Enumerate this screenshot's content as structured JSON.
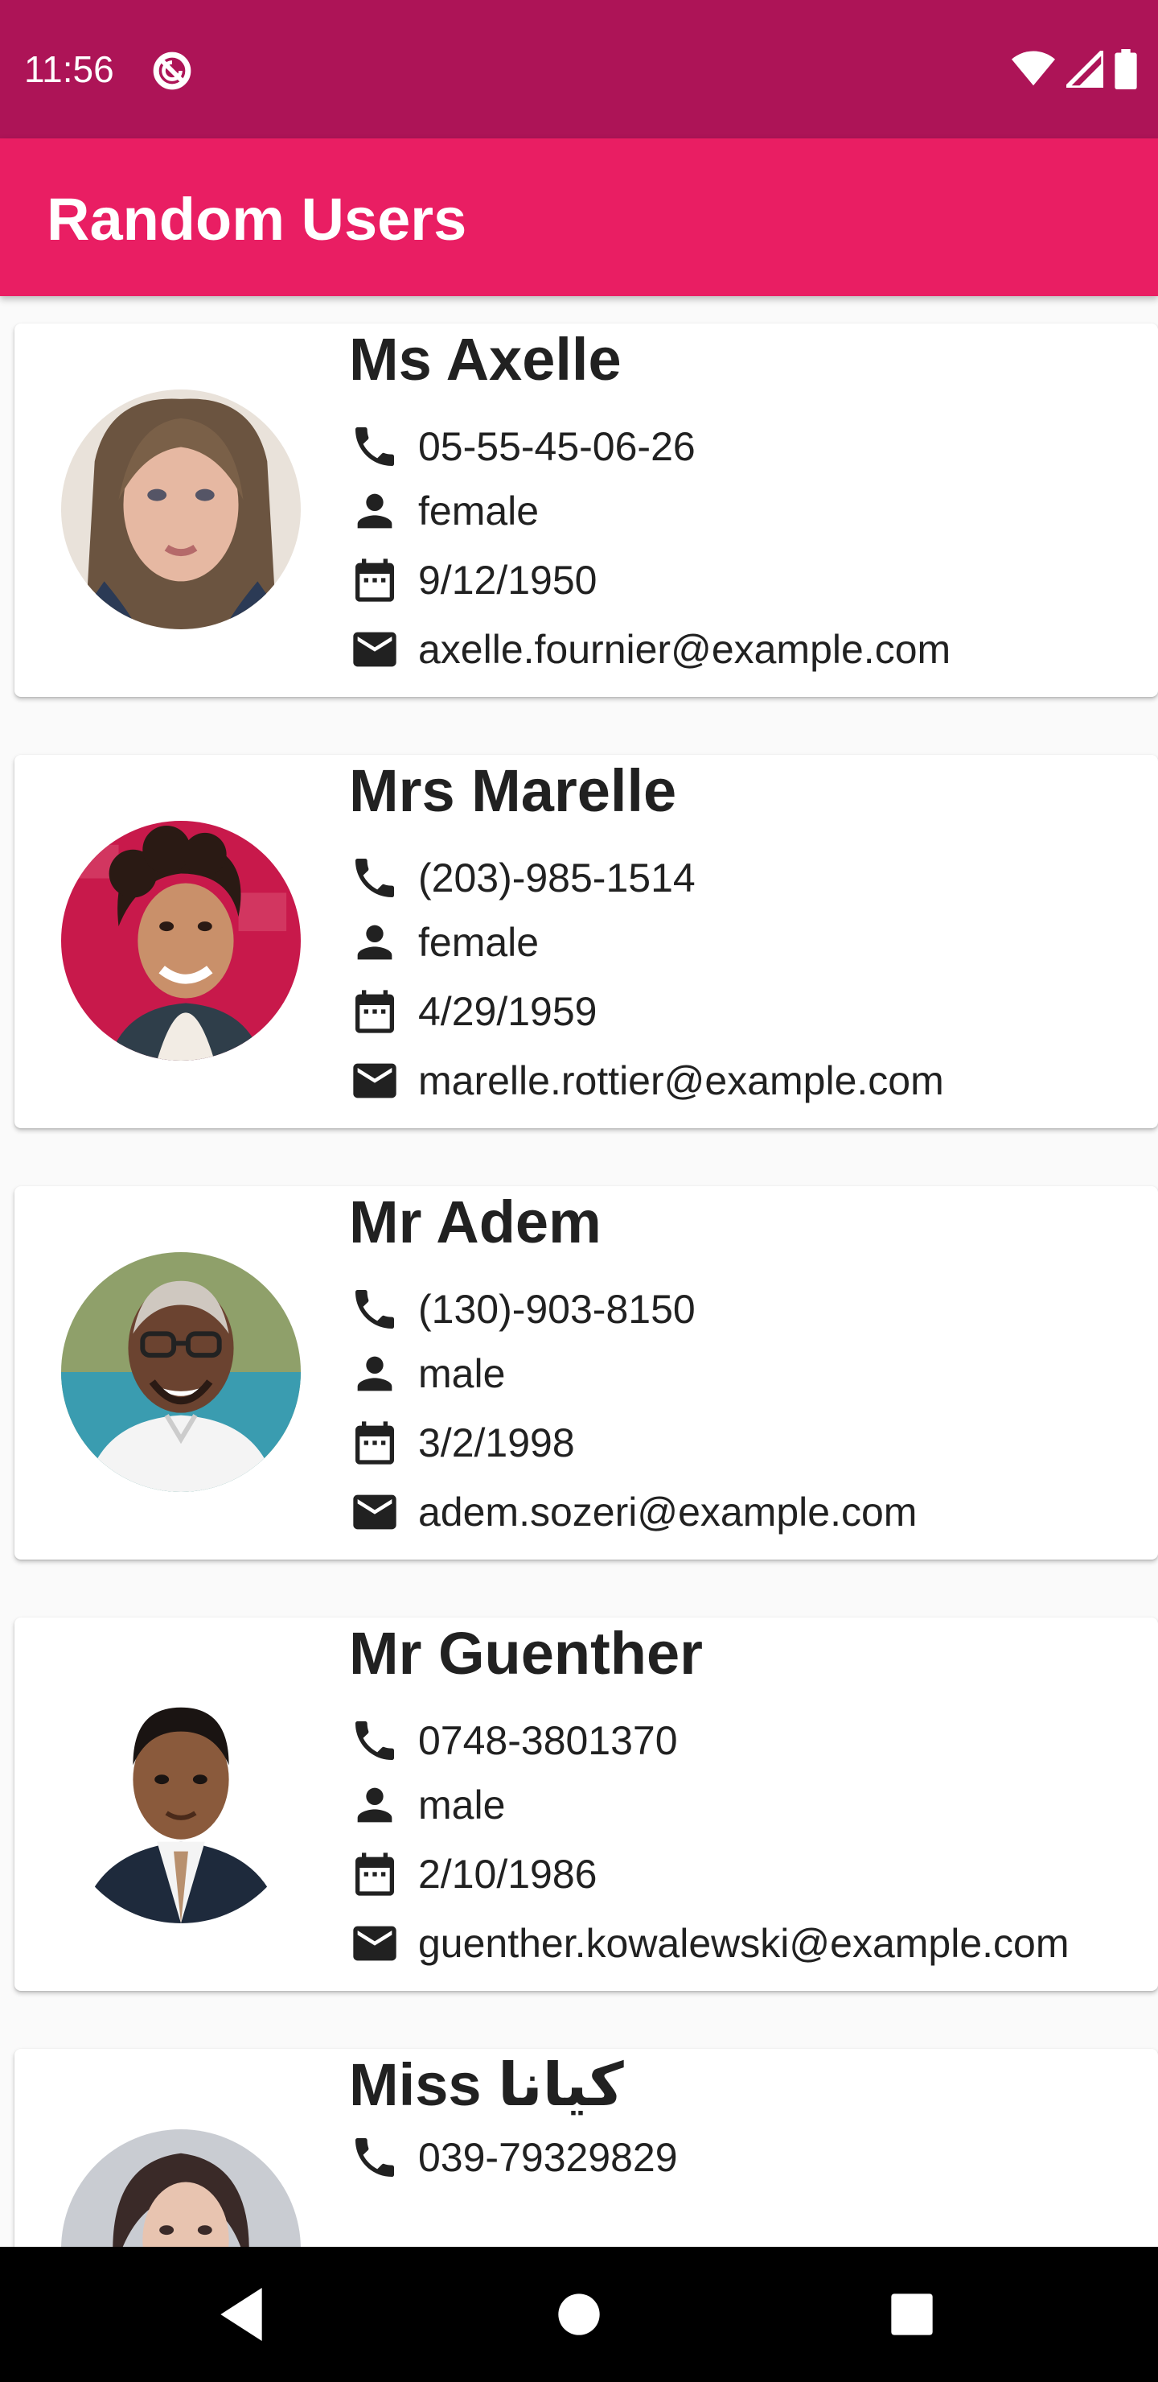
{
  "status_bar": {
    "time": "11:56",
    "icons": [
      "sync-disabled-icon",
      "wifi-icon",
      "cellular-signal-icon",
      "battery-icon"
    ],
    "color": "#ad1457"
  },
  "app_bar": {
    "title": "Random Users",
    "color": "#e91e63"
  },
  "users": [
    {
      "name": "Ms Axelle",
      "phone": "05-55-45-06-26",
      "gender": "female",
      "dob": "9/12/1950",
      "email": "axelle.fournier@example.com",
      "avatar": "woman-long-hair-portrait"
    },
    {
      "name": "Mrs Marelle",
      "phone": "(203)-985-1514",
      "gender": "female",
      "dob": "4/29/1959",
      "email": "marelle.rottier@example.com",
      "avatar": "woman-curly-hair-portrait"
    },
    {
      "name": "Mr Adem",
      "phone": "(130)-903-8150",
      "gender": "male",
      "dob": "3/2/1998",
      "email": "adem.sozeri@example.com",
      "avatar": "man-glasses-portrait"
    },
    {
      "name": "Mr Guenther",
      "phone": "0748-3801370",
      "gender": "male",
      "dob": "2/10/1986",
      "email": "guenther.kowalewski@example.com",
      "avatar": "man-suit-portrait"
    },
    {
      "name": "Miss کیانا",
      "phone": "039-79329829",
      "avatar": "woman-dark-hair-portrait"
    }
  ],
  "nav_bar": {
    "buttons": [
      "back-icon",
      "home-icon",
      "recents-icon"
    ]
  }
}
